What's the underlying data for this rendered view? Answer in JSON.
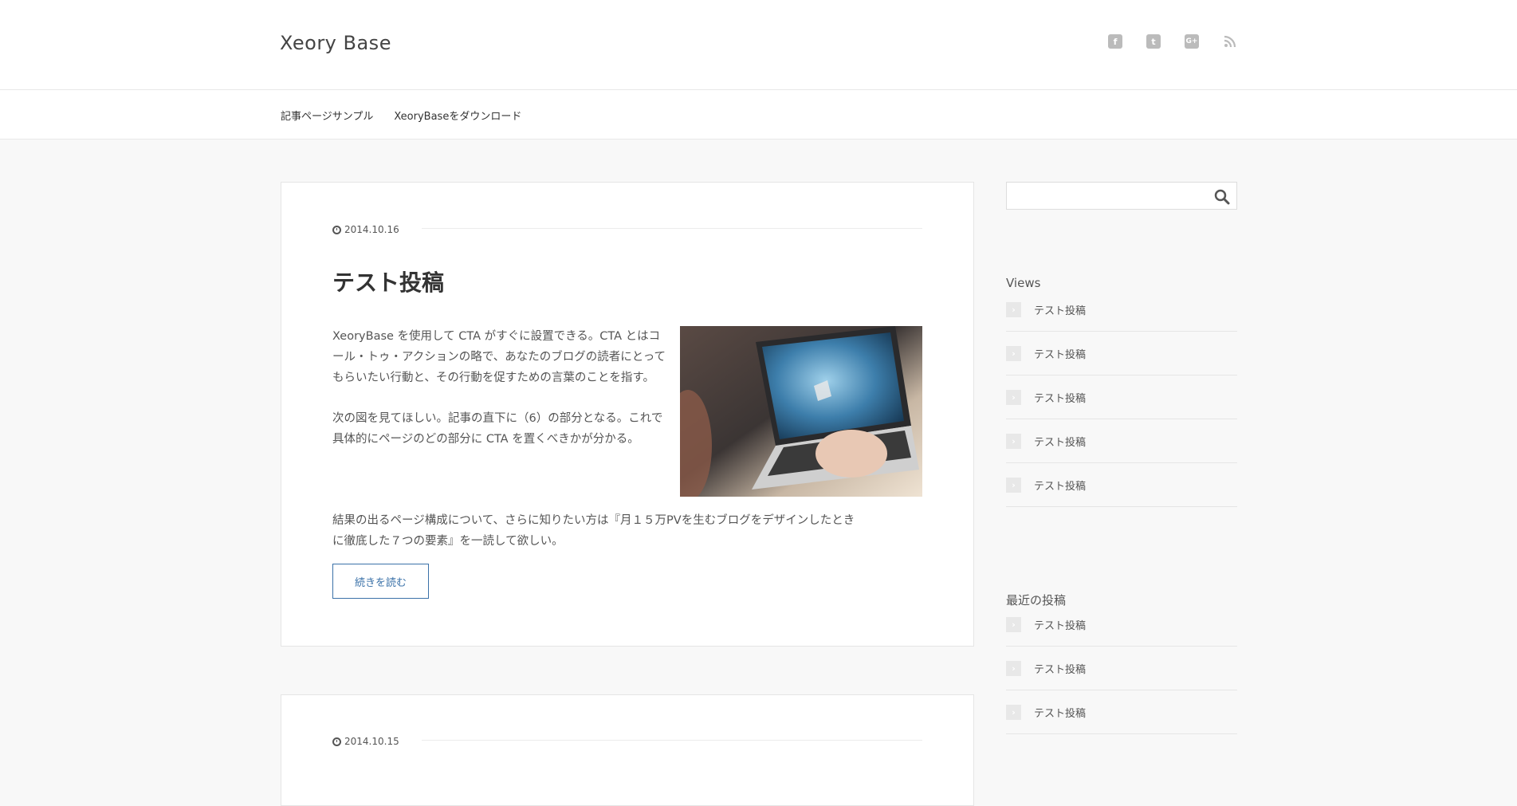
{
  "site": {
    "title": "Xeory Base"
  },
  "social": [
    {
      "name": "facebook",
      "glyph": "f"
    },
    {
      "name": "twitter",
      "glyph": "t"
    },
    {
      "name": "google-plus",
      "glyph": "G+"
    },
    {
      "name": "rss",
      "glyph": ""
    }
  ],
  "nav": {
    "items": [
      "記事ページサンプル",
      "XeoryBaseをダウンロード"
    ]
  },
  "posts": [
    {
      "date": "2014.10.16",
      "title": "テスト投稿",
      "paragraphs": [
        "XeoryBase を使用して CTA がすぐに設置できる。CTA とはコール・トゥ・アクションの略で、あなたのブログの読者にとってもらいたい行動と、その行動を促すための言葉のことを指す。",
        "次の図を見てほしい。記事の直下に（6）の部分となる。これで具体的にページのどの部分に CTA を置くべきかが分かる。"
      ],
      "wide_paragraph": "結果の出るページ構成について、さらに知りたい方は『月１５万PVを生むブログをデザインしたときに徹底した７つの要素』を一読して欲しい。",
      "read_more": "続きを読む"
    },
    {
      "date": "2014.10.15"
    }
  ],
  "sidebar": {
    "search": {
      "placeholder": "",
      "value": ""
    },
    "views": {
      "title": "Views",
      "items": [
        "テスト投稿",
        "テスト投稿",
        "テスト投稿",
        "テスト投稿",
        "テスト投稿"
      ]
    },
    "recent": {
      "title": "最近の投稿",
      "items": [
        "テスト投稿",
        "テスト投稿",
        "テスト投稿"
      ]
    }
  },
  "colors": {
    "accent": "#3a71a8",
    "icon_gray": "#bbbbbb"
  }
}
